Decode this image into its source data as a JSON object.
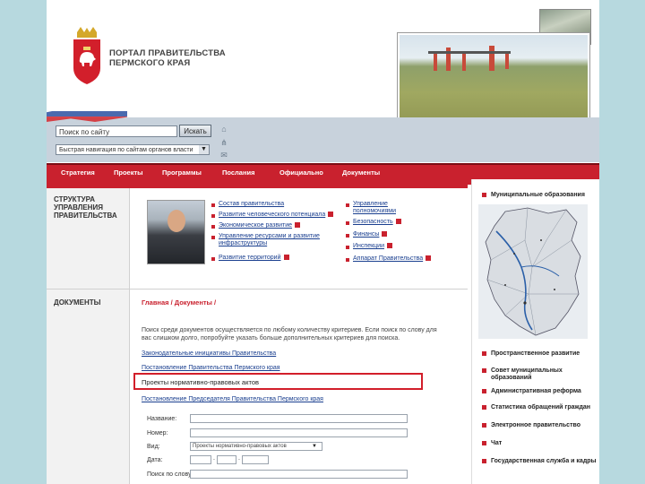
{
  "header": {
    "title_line1": "ПОРТАЛ ПРАВИТЕЛЬСТВА",
    "title_line2": "ПЕРМСКОГО КРАЯ",
    "logo_icon": "coat-of-arms-icon"
  },
  "search": {
    "placeholder": "Поиск по сайту",
    "button_label": "Искать",
    "quick_nav_label": "Быстрая навигация по сайтам органов власти"
  },
  "menu": [
    "Стратегия",
    "Проекты",
    "Программы",
    "Послания",
    "Официально",
    "Документы"
  ],
  "left": {
    "structure_title": "СТРУКТУРА УПРАВЛЕНИЯ ПРАВИТЕЛЬСТВА",
    "documents_title": "ДОКУМЕНТЫ"
  },
  "structure_links_col1": [
    "Состав правительства",
    "Развитие человеческого потенциала",
    "Экономическое развитие",
    "Управление ресурсами и развитие инфраструктуры",
    "Развитие территорий"
  ],
  "structure_links_col2": [
    "Управление полномочиями",
    "Безопасность",
    "Финансы",
    "Инспекции",
    "Аппарат Правительства"
  ],
  "main": {
    "breadcrumb": "Главная / Документы /",
    "notice": "Поиск среди документов осуществляется по любому количеству критериев. Если поиск по слову для вас слишком долго, попробуйте указать больше дополнительных критериев для поиска.",
    "doc_links": [
      "Законодательные инициативы Правительства",
      "Постановление Правительства Пермского края"
    ],
    "highlighted": "Проекты нормативно-правовых актов",
    "doc_link_after": "Постановление Председателя Правительства Пермского края",
    "form": {
      "name_label": "Название:",
      "number_label": "Номер:",
      "type_label": "Вид:",
      "type_value": "Проекты нормативно-правовых актов",
      "date_label": "Дата:",
      "date_sep": ".",
      "word_label": "Поиск по слову:"
    }
  },
  "right": {
    "top_link": "Муниципальные образования",
    "links": [
      "Пространственное развитие",
      "Совет муниципальных образований",
      "Административная реформа",
      "Статистика обращений граждан",
      "Электронное правительство",
      "Чат",
      "Государственная служба и кадры"
    ]
  },
  "colors": {
    "accent": "#c9212e",
    "link": "#1a3f8f",
    "background": "#b7d9df"
  }
}
